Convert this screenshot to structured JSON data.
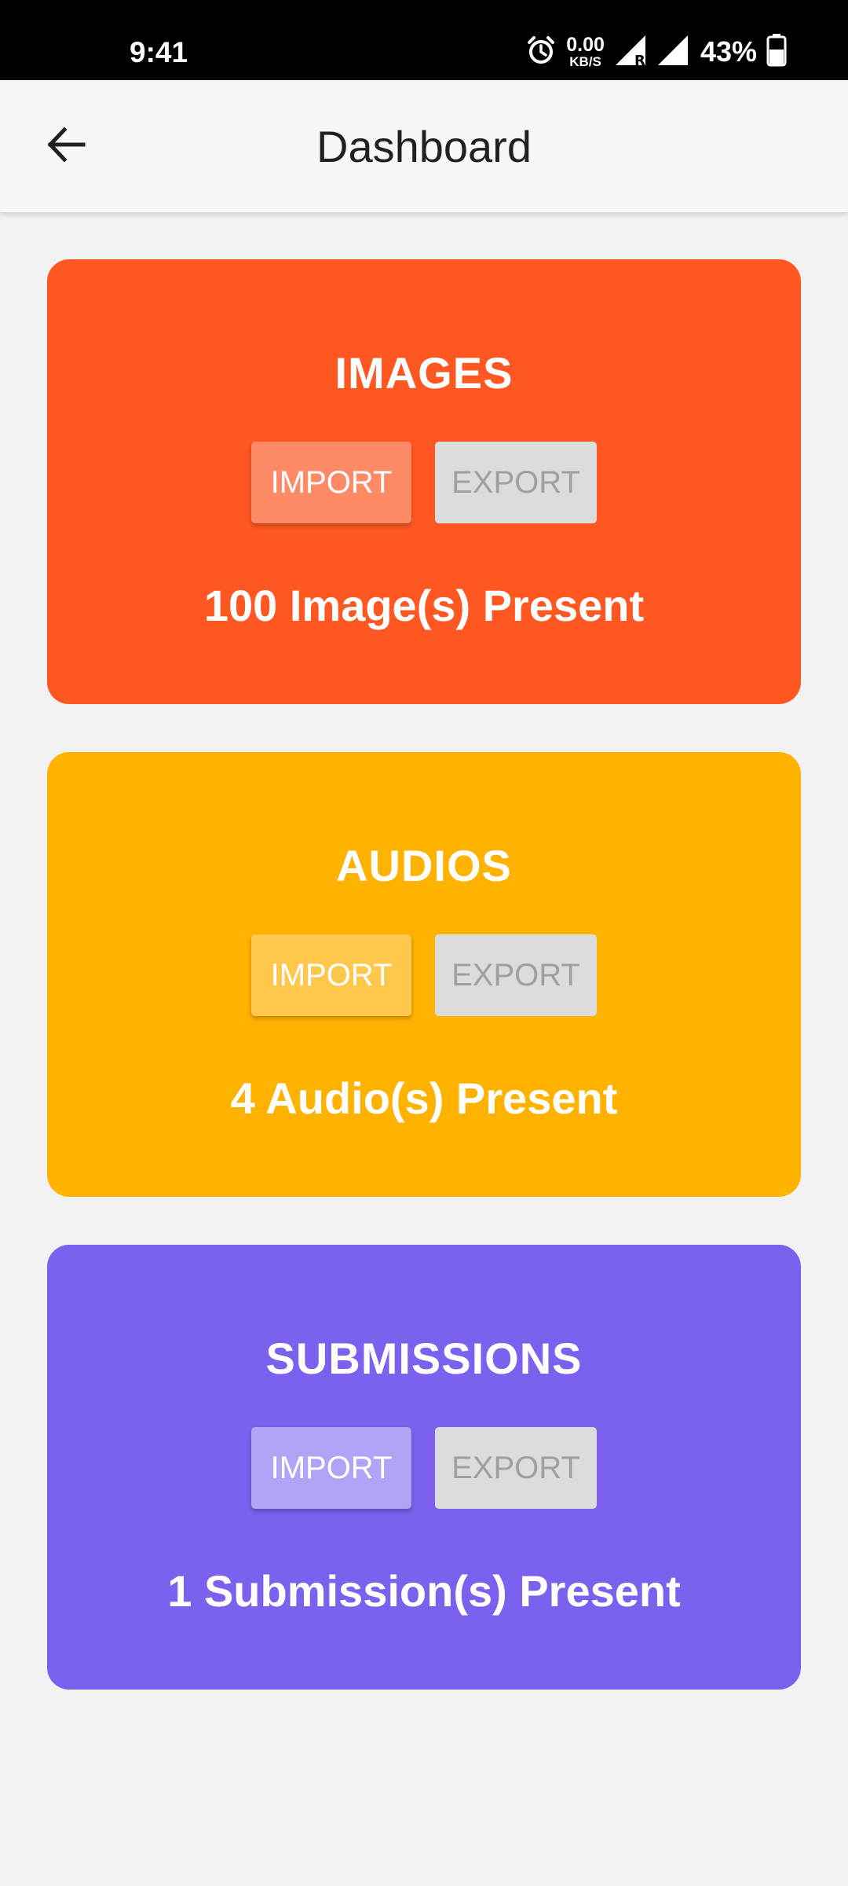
{
  "status_bar": {
    "time": "9:41",
    "net_speed_value": "0.00",
    "net_speed_unit": "KB/S",
    "battery_percent": "43%",
    "icons": [
      "alarm-icon",
      "cell-signal-roaming-icon",
      "cell-signal-icon",
      "battery-icon"
    ]
  },
  "app_bar": {
    "back_icon": "arrow-left-icon",
    "title": "Dashboard"
  },
  "cards": [
    {
      "title": "IMAGES",
      "import_label": "IMPORT",
      "export_label": "EXPORT",
      "count_text": "100 Image(s) Present",
      "color": "#ff5722",
      "import_color": "#ff8a66"
    },
    {
      "title": "AUDIOS",
      "import_label": "IMPORT",
      "export_label": "EXPORT",
      "count_text": "4 Audio(s) Present",
      "color": "#ffb300",
      "import_color": "#ffc84d"
    },
    {
      "title": "SUBMISSIONS",
      "import_label": "IMPORT",
      "export_label": "EXPORT",
      "count_text": "1 Submission(s) Present",
      "color": "#7b61ee",
      "import_color": "#b3a2f6"
    }
  ],
  "colors": {
    "background": "#f2f2f2",
    "app_bar": "#f7f7f7",
    "export_button": "#dcdcdc",
    "export_text": "#a0a0a0"
  }
}
